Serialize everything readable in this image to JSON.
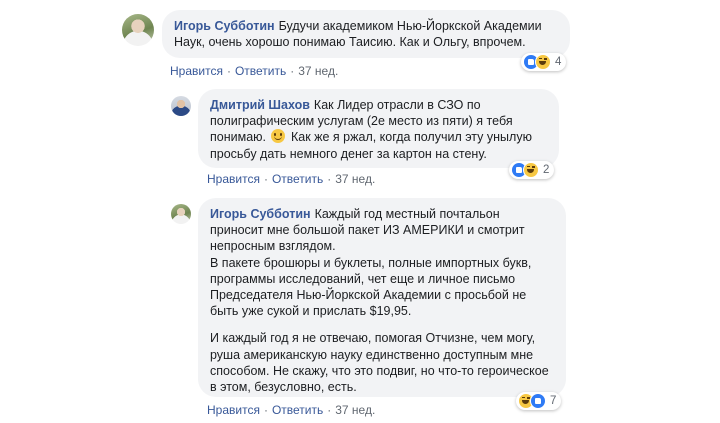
{
  "comments": [
    {
      "author": "Игорь Субботин",
      "paragraphs": [
        {
          "lines": [
            "Будучи академиком Нью-Йоркской Академии",
            "Наук, очень хорошо понимаю Таисию. Как и Ольгу, впрочем."
          ]
        }
      ],
      "like": "Нравится",
      "reply": "Ответить",
      "time": "37 нед.",
      "reaction_count": "4"
    },
    {
      "author": "Дмитрий Шахов",
      "text_before_emoji": "Как Лидер отрасли в СЗО по полиграфическим услугам (2е место из пяти) я тебя понимаю.",
      "text_after_emoji": "Как же я ржал, когда получил эту унылую просьбу дать немного денег за картон на стену.",
      "like": "Нравится",
      "reply": "Ответить",
      "time": "37 нед.",
      "reaction_count": "2"
    },
    {
      "author": "Игорь Субботин",
      "paragraph1": "Каждый год местный почтальон приносит мне большой пакет ИЗ АМЕРИКИ и смотрит непросным взглядом.",
      "paragraph2": "В пакете брошюры и буклеты, полные импортных букв, программы исследований, чет еще и личное письмо Председателя Нью-Йоркской Академии с просьбой не быть уже сукой и прислать $19,95.",
      "paragraph3": "И каждый год я не отвечаю, помогая Отчизне, чем могу, руша американскую науку единственно доступным мне способом. Не скажу, что это подвиг, но что-то героическое в этом, безусловно, есть.",
      "like": "Нравится",
      "reply": "Ответить",
      "time": "37 нед.",
      "reaction_count": "7"
    }
  ],
  "separator": "·",
  "icons": {
    "like": "like-reaction-icon",
    "haha": "haha-reaction-icon",
    "smile": "smile-emoji-icon"
  },
  "colors": {
    "link": "#385898",
    "bubble": "#f2f3f5",
    "meta": "#606770",
    "like_blue": "#2f7bf5",
    "emoji_yellow": "#f7c843"
  }
}
